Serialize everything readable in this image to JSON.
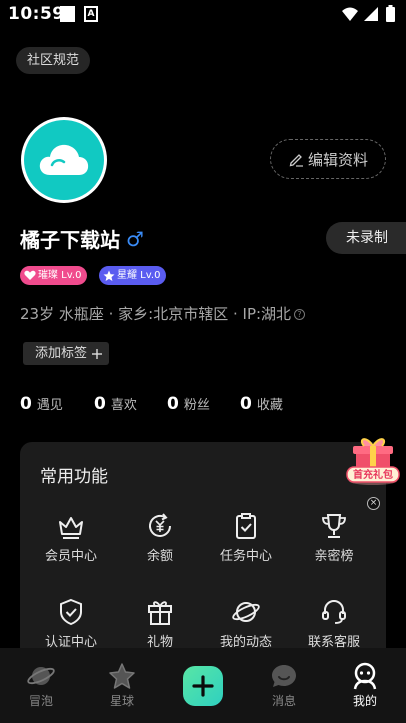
{
  "status_bar": {
    "time": "10:59"
  },
  "community_rules_label": "社区规范",
  "edit_profile_label": "编辑资料",
  "username": "橘子下载站",
  "gender_symbol": "♂",
  "unrecorded_label": "未录制",
  "badges": [
    {
      "text": "璀璨 Lv.0",
      "color": "#f04b8d"
    },
    {
      "text": "星耀 Lv.0",
      "color": "#5a5cf0"
    }
  ],
  "info_line": "23岁 水瓶座 · 家乡:北京市辖区 · IP:湖北",
  "info_help_glyph": "?",
  "add_tag_label": "添加标签",
  "stats": [
    {
      "num": "0",
      "label": "遇见"
    },
    {
      "num": "0",
      "label": "喜欢"
    },
    {
      "num": "0",
      "label": "粉丝"
    },
    {
      "num": "0",
      "label": "收藏"
    }
  ],
  "functions": {
    "title": "常用功能",
    "items": [
      {
        "label": "会员中心",
        "icon": "crown-icon"
      },
      {
        "label": "余额",
        "icon": "yuan-refresh-icon"
      },
      {
        "label": "任务中心",
        "icon": "clipboard-check-icon"
      },
      {
        "label": "亲密榜",
        "icon": "trophy-icon"
      },
      {
        "label": "认证中心",
        "icon": "shield-check-icon"
      },
      {
        "label": "礼物",
        "icon": "gift-box-icon"
      },
      {
        "label": "我的动态",
        "icon": "planet-icon"
      },
      {
        "label": "联系客服",
        "icon": "headset-icon"
      }
    ]
  },
  "gift_banner": {
    "label": "首充礼包",
    "close_glyph": "×"
  },
  "tabbar": {
    "items": [
      {
        "label": "冒泡",
        "icon": "planet-tab-icon"
      },
      {
        "label": "星球",
        "icon": "star-tab-icon"
      },
      {
        "label": "消息",
        "icon": "chat-bubble-tab-icon"
      },
      {
        "label": "我的",
        "icon": "profile-tab-icon",
        "active": true
      }
    ],
    "plus_icon": "plus-icon"
  },
  "colors": {
    "background": "#000000",
    "avatar_bg": "#11c9c2",
    "gender_blue": "#3a8cf7",
    "plus_gradient_start": "#58e6a5",
    "plus_gradient_end": "#2fd0c0"
  }
}
